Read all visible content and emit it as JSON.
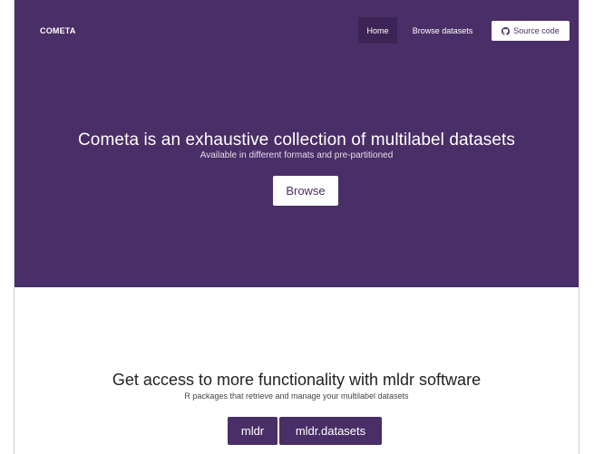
{
  "navbar": {
    "brand": "COMETA",
    "links": [
      {
        "label": "Home",
        "active": true
      },
      {
        "label": "Browse datasets",
        "active": false
      }
    ],
    "source_button": {
      "label": "Source code",
      "icon": "github-icon"
    }
  },
  "hero": {
    "title": "Cometa is an exhaustive collection of multilabel datasets",
    "subtitle": "Available in different formats and pre-partitioned",
    "button_label": "Browse"
  },
  "software": {
    "title": "Get access to more functionality with mldr software",
    "subtitle": "R packages that retrieve and manage your multilabel datasets",
    "buttons": [
      {
        "label": "mldr"
      },
      {
        "label": "mldr.datasets"
      }
    ]
  },
  "colors": {
    "brand_purple": "#4a2e67",
    "active_nav": "#3d2456",
    "white": "#ffffff"
  }
}
